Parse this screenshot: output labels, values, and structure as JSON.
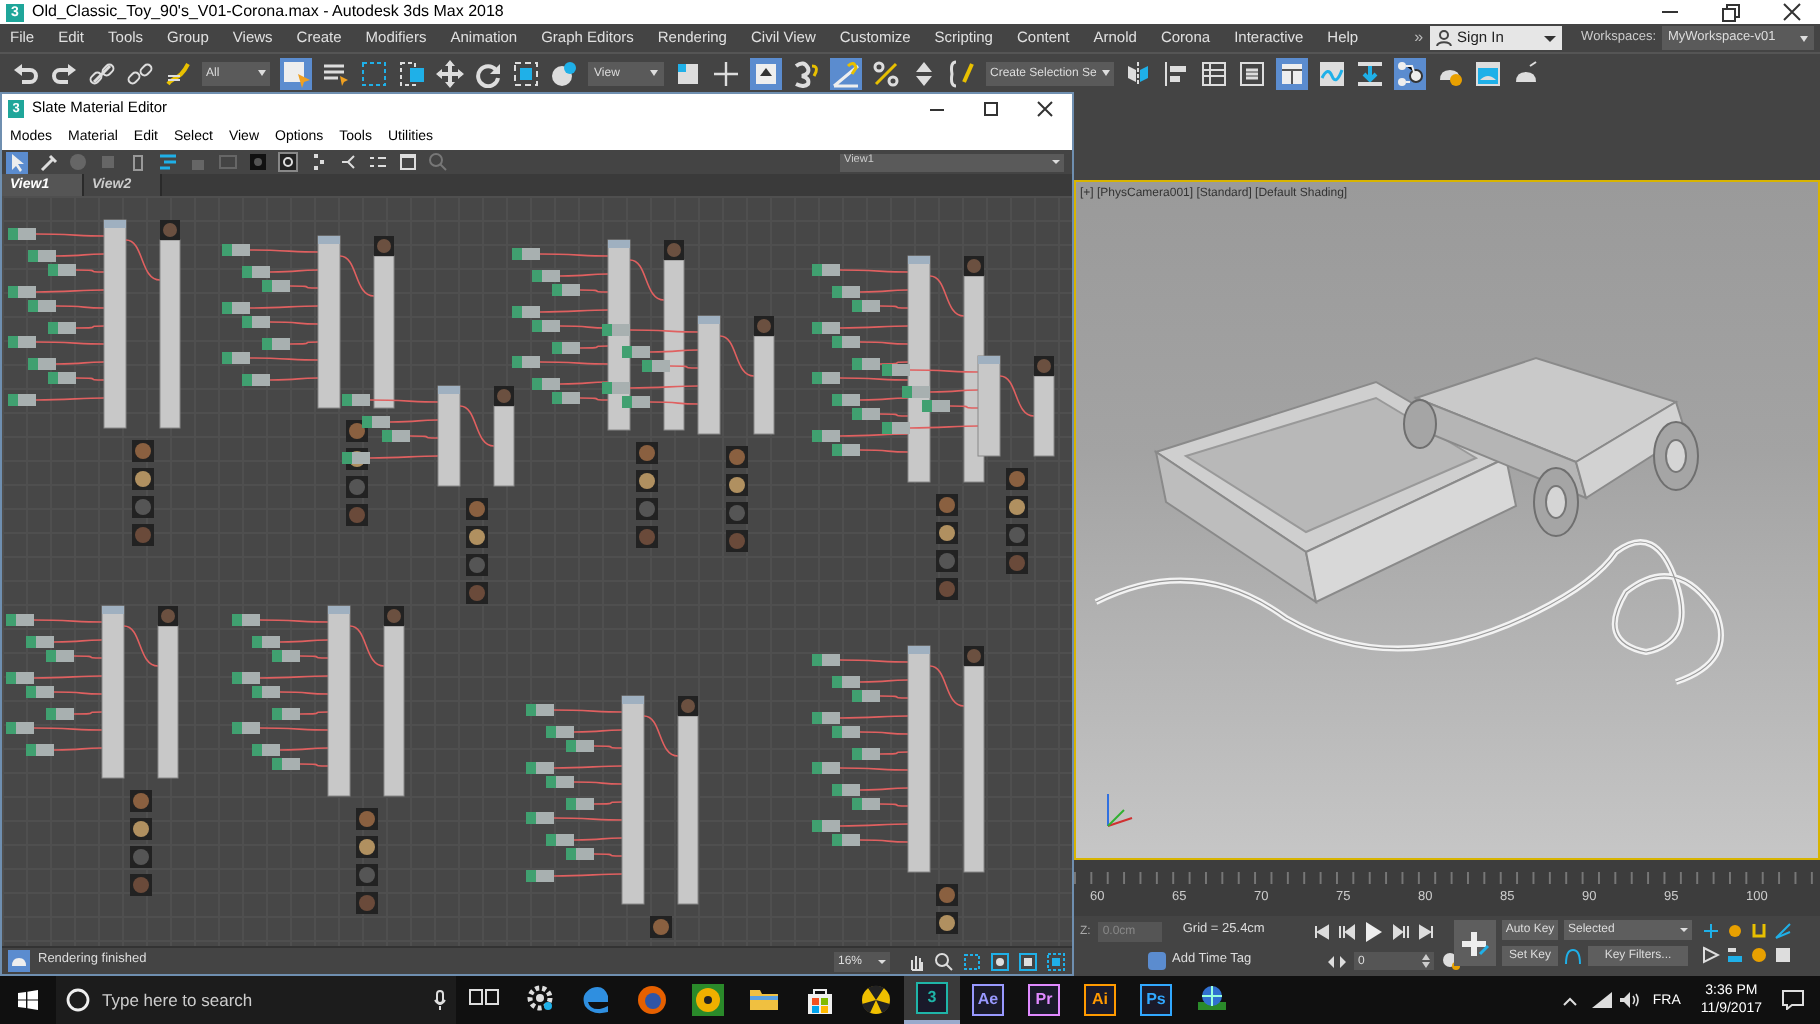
{
  "app_window": {
    "icon_glyph": "3",
    "title": "Old_Classic_Toy_90's_V01-Corona.max - Autodesk 3ds Max 2018",
    "menu": [
      "File",
      "Edit",
      "Tools",
      "Group",
      "Views",
      "Create",
      "Modifiers",
      "Animation",
      "Graph Editors",
      "Rendering",
      "Civil View",
      "Customize",
      "Scripting",
      "Content",
      "Arnold",
      "Corona",
      "Interactive",
      "Help"
    ],
    "more": "»",
    "sign_in": "Sign In",
    "workspaces_label": "Workspaces:",
    "workspace": "MyWorkspace-v01",
    "toolbar": {
      "selection_filter": "All",
      "reference_coordinate": "View",
      "named_selection": "Create Selection Se"
    }
  },
  "slate_editor": {
    "icon_glyph": "3",
    "title": "Slate Material Editor",
    "menu": [
      "Modes",
      "Material",
      "Edit",
      "Select",
      "View",
      "Options",
      "Tools",
      "Utilities"
    ],
    "view_dropdown": "View1",
    "tabs": [
      {
        "label": "View1",
        "selected": true
      },
      {
        "label": "View2",
        "selected": false
      }
    ],
    "status": "Rendering finished",
    "zoom": "16%"
  },
  "viewport": {
    "label": "[+] [PhysCamera001] [Standard] [Default Shading]",
    "active": true
  },
  "timeline": {
    "ticks": [
      "60",
      "65",
      "70",
      "75",
      "80",
      "85",
      "90",
      "95",
      "100"
    ]
  },
  "animation_controls": {
    "z_label": "Z:",
    "z_value": "0.0cm",
    "grid": "Grid = 25.4cm",
    "add_time_tag": "Add Time Tag",
    "frame": "0",
    "auto_key": "Auto Key",
    "set_key": "Set Key",
    "key_mode": "Selected",
    "key_filters": "Key Filters..."
  },
  "taskbar": {
    "search_placeholder": "Type here to search",
    "language": "FRA",
    "time": "3:36 PM",
    "date": "11/9/2017",
    "apps": [
      {
        "kind": "task-view",
        "selected": false
      },
      {
        "kind": "gear",
        "selected": false
      },
      {
        "kind": "edge",
        "selected": false
      },
      {
        "kind": "firefox",
        "selected": false
      },
      {
        "kind": "disc",
        "selected": false
      },
      {
        "kind": "folder",
        "selected": false
      },
      {
        "kind": "store",
        "selected": false
      },
      {
        "kind": "radiation",
        "selected": false
      },
      {
        "kind": "letter",
        "label": "3",
        "color": "#1fb5a8",
        "selected": true
      },
      {
        "kind": "letter",
        "label": "Ae",
        "color": "#9999ff",
        "selected": false
      },
      {
        "kind": "letter",
        "label": "Pr",
        "color": "#e08aff",
        "selected": false
      },
      {
        "kind": "letter",
        "label": "Ai",
        "color": "#ff9a00",
        "selected": false
      },
      {
        "kind": "letter",
        "label": "Ps",
        "color": "#31a8ff",
        "selected": false
      },
      {
        "kind": "network",
        "selected": false
      }
    ]
  }
}
